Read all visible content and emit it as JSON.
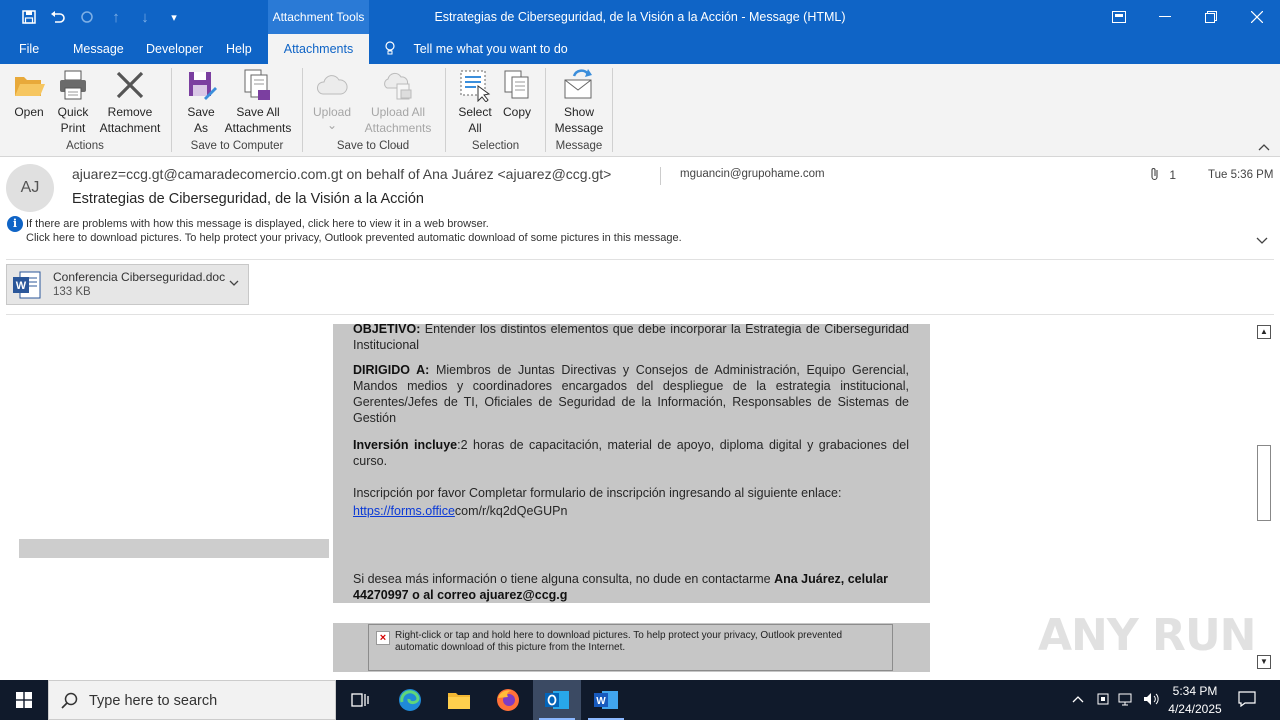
{
  "window": {
    "title": "Estrategias de Ciberseguridad, de la Visión a la Acción  -  Message (HTML)",
    "contextual_tab_group": "Attachment Tools"
  },
  "tabs": [
    {
      "label": "File"
    },
    {
      "label": "Message"
    },
    {
      "label": "Developer"
    },
    {
      "label": "Help"
    },
    {
      "label": "Attachments",
      "active": true
    }
  ],
  "tell_me": "Tell me what you want to do",
  "ribbon": {
    "buttons": {
      "open": [
        "Open",
        ""
      ],
      "quick_print": [
        "Quick",
        "Print"
      ],
      "remove_attachment": [
        "Remove",
        "Attachment"
      ],
      "save_as": [
        "Save",
        "As"
      ],
      "save_all_attachments": [
        "Save All",
        "Attachments"
      ],
      "upload": [
        "Upload",
        "⌄"
      ],
      "upload_all_attachments": [
        "Upload All",
        "Attachments ⌄"
      ],
      "select_all": [
        "Select",
        "All"
      ],
      "copy": [
        "Copy",
        ""
      ],
      "show_message": [
        "Show",
        "Message"
      ]
    },
    "groups": {
      "actions": "Actions",
      "save_to_computer": "Save to Computer",
      "save_to_cloud": "Save to Cloud",
      "selection": "Selection",
      "message": "Message"
    }
  },
  "header": {
    "avatar_initials": "AJ",
    "from": "ajuarez=ccg.gt@camaradecomercio.com.gt on behalf of Ana Juárez <ajuarez@ccg.gt>",
    "to": "mguancin@grupohame.com",
    "attachment_count": "1",
    "date": "Tue 5:36 PM",
    "subject": "Estrategias de Ciberseguridad, de la Visión a la Acción",
    "info_line1": "If there are problems with how this message is displayed, click here to view it in a web browser.",
    "info_line2": "Click here to download pictures. To help protect your privacy, Outlook prevented automatic download of some pictures in this message."
  },
  "attachment": {
    "name": "Conferencia Ciberseguridad.doc",
    "size": "133 KB"
  },
  "body": {
    "objetivo_label": "OBJETIVO:",
    "objetivo_text": " Entender los distintos elementos que debe incorporar la Estrategia de Ciberseguridad Institucional",
    "dirigido_label": "DIRIGIDO A:",
    "dirigido_text": " Miembros de Juntas Directivas y Consejos de Administración, Equipo Gerencial, Mandos medios y coordinadores encargados del despliegue de la estrategia institucional, Gerentes/Jefes de TI, Oficiales de Seguridad de la Información, Responsables de Sistemas de Gestión",
    "inversion_label": "Inversión incluye",
    "inversion_text": ":2 horas de capacitación, material de apoyo, diploma digital y grabaciones del curso.",
    "inscripcion_text": "Inscripción por favor Completar formulario de inscripción ingresando al siguiente enlace:",
    "link_part1": "https://forms.office",
    "link_part2": "com/r/kq2dQeGUPn",
    "contact_text": "Si desea más información o tiene alguna consulta, no dude en contactarme ",
    "contact_bold": "Ana Juárez, celular 44270997  o al correo  ajuarez@ccg.g",
    "picture_blocked": "Right-click or tap and hold here to download pictures. To help protect your privacy, Outlook prevented automatic download of this picture from the Internet."
  },
  "watermark": "ANY RUN",
  "taskbar": {
    "search_placeholder": "Type here to search",
    "time": "5:34 PM",
    "date": "4/24/2025",
    "apps": [
      "task-view",
      "edge",
      "file-explorer",
      "firefox",
      "outlook",
      "word"
    ]
  },
  "colors": {
    "accent": "#0f64c6",
    "ribbon_bg": "#f3f3f3",
    "body_bg": "#c6c6c6",
    "taskbar_bg": "#101a2b"
  }
}
